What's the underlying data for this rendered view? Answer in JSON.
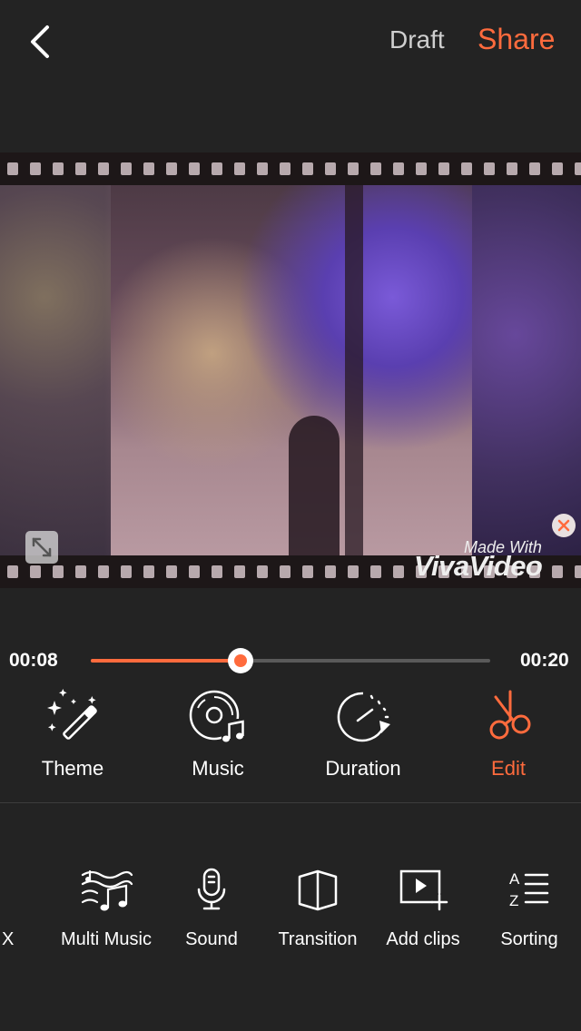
{
  "header": {
    "draft_label": "Draft",
    "share_label": "Share"
  },
  "preview": {
    "watermark_made": "Made With",
    "watermark_brand": "VivaVideo"
  },
  "timeline": {
    "current": "00:08",
    "total": "00:20",
    "progress": 0.376
  },
  "tabs": [
    {
      "label": "Theme",
      "icon": "magic-wand-icon"
    },
    {
      "label": "Music",
      "icon": "music-disc-icon"
    },
    {
      "label": "Duration",
      "icon": "timer-icon"
    },
    {
      "label": "Edit",
      "icon": "scissors-icon",
      "active": true
    }
  ],
  "tools": [
    {
      "label": "X",
      "icon": "close-icon"
    },
    {
      "label": "Multi Music",
      "icon": "multi-music-icon"
    },
    {
      "label": "Sound",
      "icon": "microphone-icon"
    },
    {
      "label": "Transition",
      "icon": "transition-icon"
    },
    {
      "label": "Add clips",
      "icon": "add-clip-icon"
    },
    {
      "label": "Sorting",
      "icon": "sort-az-icon"
    }
  ],
  "colors": {
    "accent": "#ff6b3d",
    "background": "#232323"
  }
}
